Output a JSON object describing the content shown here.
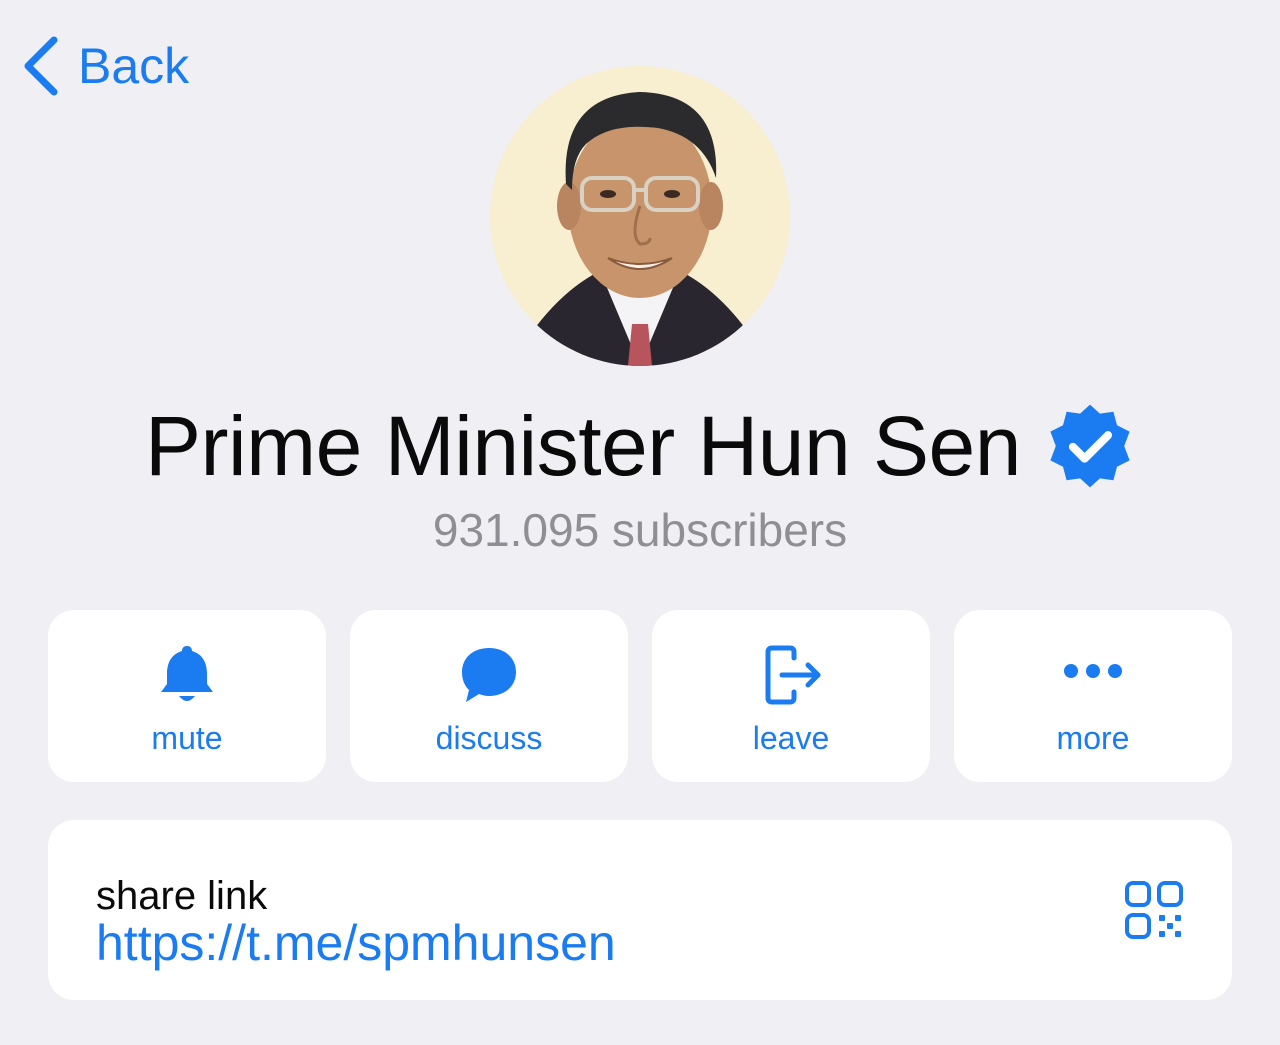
{
  "nav": {
    "back_label": "Back"
  },
  "profile": {
    "name": "Prime Minister Hun Sen",
    "subscribers": "931.095 subscribers",
    "verified_icon": "verified-badge-icon"
  },
  "actions": [
    {
      "label": "mute",
      "icon": "bell-icon"
    },
    {
      "label": "discuss",
      "icon": "chat-bubble-icon"
    },
    {
      "label": "leave",
      "icon": "leave-icon"
    },
    {
      "label": "more",
      "icon": "more-dots-icon"
    }
  ],
  "share": {
    "title": "share link",
    "link": "https://t.me/spmhunsen",
    "qr_icon": "qr-code-icon"
  },
  "colors": {
    "accent": "#1a7cf0",
    "background": "#efeff4",
    "card": "#ffffff",
    "secondary_text": "#8e8e93"
  }
}
